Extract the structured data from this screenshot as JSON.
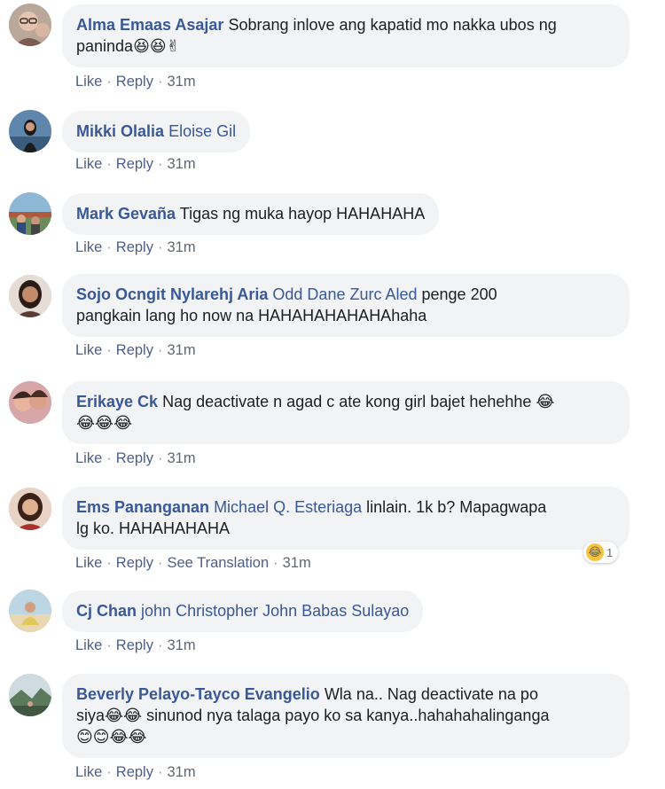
{
  "actions": {
    "like": "Like",
    "reply": "Reply",
    "see_translation": "See Translation",
    "sep": "·"
  },
  "colors": {
    "author": "#385898",
    "bubble": "#f2f3f5",
    "action": "#606770"
  },
  "comments": [
    {
      "author": "Alma Emaas Asajar",
      "mention": "",
      "text_line1": "Sobrang inlove ang kapatid mo nakka ubos ng",
      "text_line2": "paninda",
      "emojis": "😆😆✌",
      "time": "31m",
      "avatar_icon": "avatar-woman-glasses-icon"
    },
    {
      "author": "Mikki Olalia",
      "mention": "Eloise Gil",
      "text_line1": "",
      "time": "31m",
      "avatar_icon": "avatar-woman-dark-icon"
    },
    {
      "author": "Mark Gevaña",
      "mention": "",
      "text_line1": "Tigas ng muka hayop HAHAHAHA",
      "time": "31m",
      "avatar_icon": "avatar-outdoor-group-icon"
    },
    {
      "author": "Sojo Ocngit Nylarehj Aria",
      "mention": "Odd Dane Zurc Aled",
      "text_line1": "penge 200",
      "text_line2": "pangkain lang ho now na HAHAHAHAHAHAhaha",
      "time": "31m",
      "avatar_icon": "avatar-woman-portrait-icon"
    },
    {
      "author": "Erikaye Ck",
      "mention": "",
      "text_line1": "Nag deactivate n agad c ate kong girl bajet hehehhe",
      "emoji_inline": "😂",
      "emojis": "😂😂😂",
      "time": "31m",
      "avatar_icon": "avatar-two-people-icon"
    },
    {
      "author": "Ems Pananganan",
      "mention": "Michael Q. Esteriaga",
      "text_line1": "linlain. 1k b? Mapagwapa",
      "text_line2": "lg ko. HAHAHAHAHA",
      "time": "31m",
      "reaction_emoji": "😂",
      "reaction_count": "1",
      "avatar_icon": "avatar-woman-red-icon"
    },
    {
      "author": "Cj Chan",
      "mention": "john",
      "mention2": "Christopher John Babas Sulayao",
      "text_line1": "",
      "time": "31m",
      "avatar_icon": "avatar-beach-icon"
    },
    {
      "author": "Beverly Pelayo-Tayco Evangelio",
      "mention": "",
      "text_line1": "Wla na.. Nag deactivate na po",
      "text_line2_pre": "siya",
      "emoji_mid": "😂😂",
      "text_line2": "sinunod nya talaga payo ko sa kanya..hahahahalinganga",
      "emojis": "😊😊😂😂",
      "time": "31m",
      "avatar_icon": "avatar-landscape-icon"
    }
  ]
}
